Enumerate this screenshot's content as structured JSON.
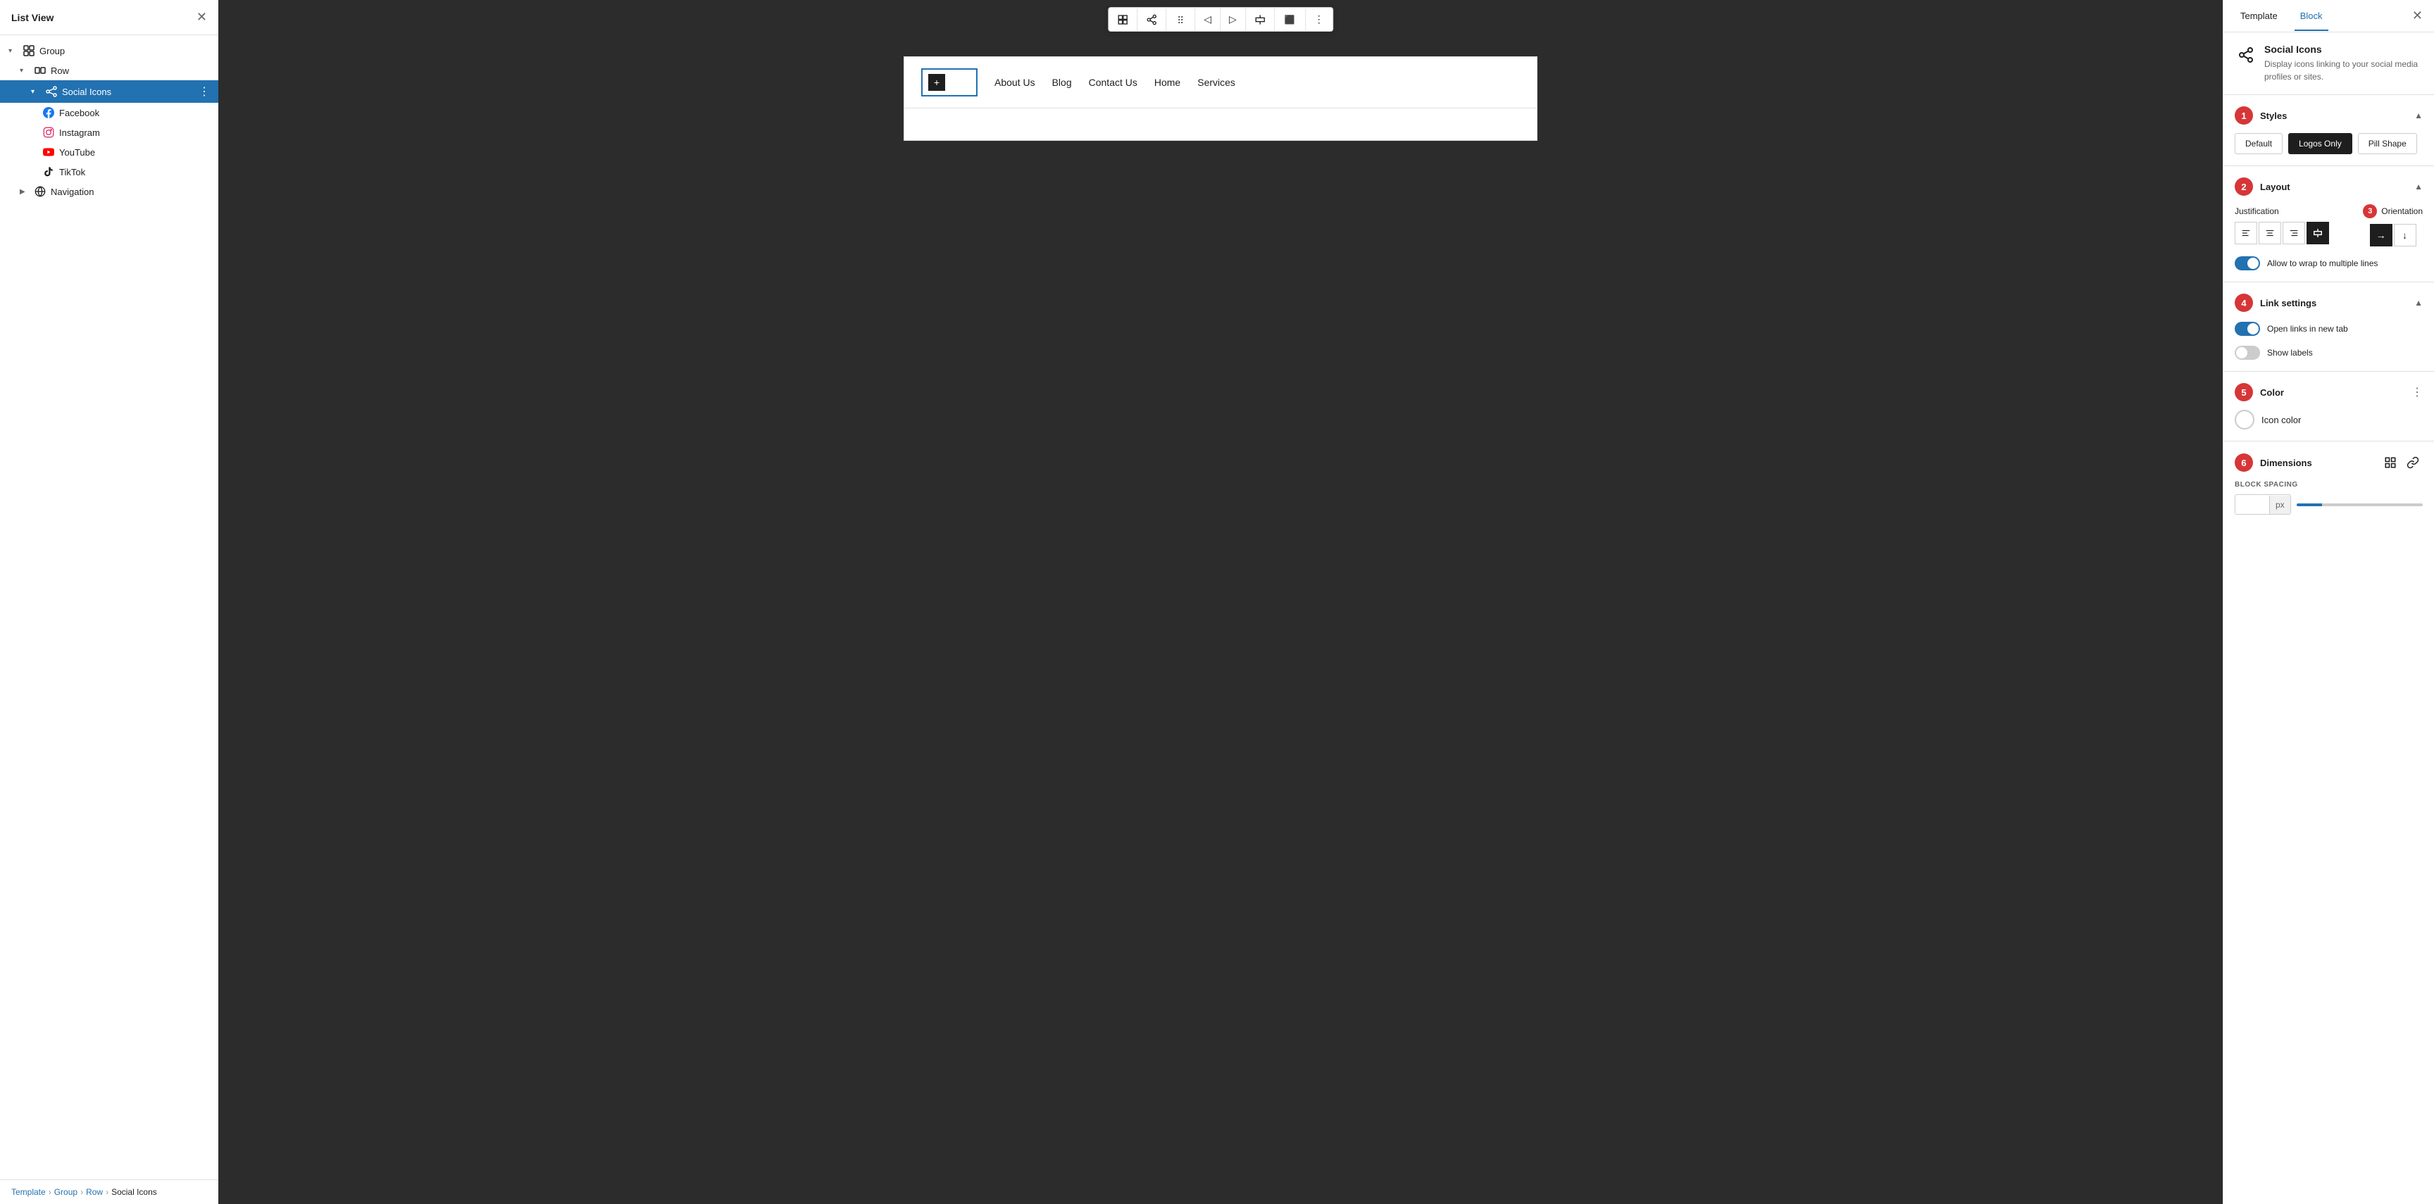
{
  "leftPanel": {
    "title": "List View",
    "tree": [
      {
        "id": "group",
        "label": "Group",
        "icon": "group",
        "level": 0,
        "chevron": "▾",
        "expanded": true
      },
      {
        "id": "row",
        "label": "Row",
        "icon": "row",
        "level": 1,
        "chevron": "▾",
        "expanded": true
      },
      {
        "id": "social-icons",
        "label": "Social Icons",
        "icon": "share",
        "level": 2,
        "chevron": "▾",
        "expanded": true,
        "selected": true
      },
      {
        "id": "facebook",
        "label": "Facebook",
        "icon": "facebook",
        "level": 3
      },
      {
        "id": "instagram",
        "label": "Instagram",
        "icon": "instagram",
        "level": 3
      },
      {
        "id": "youtube",
        "label": "YouTube",
        "icon": "youtube",
        "level": 3
      },
      {
        "id": "tiktok",
        "label": "TikTok",
        "icon": "tiktok",
        "level": 3
      },
      {
        "id": "navigation",
        "label": "Navigation",
        "icon": "navigation",
        "level": 1,
        "chevron": "▶"
      }
    ]
  },
  "breadcrumb": {
    "items": [
      "Template",
      "Group",
      "Row",
      "Social Icons"
    ]
  },
  "canvas": {
    "navLinks": [
      "About Us",
      "Blog",
      "Contact Us",
      "Home",
      "Services"
    ]
  },
  "toolbar": {
    "buttons": [
      "⊞",
      "◁",
      "⋮",
      "◁▷",
      "⬛"
    ]
  },
  "rightPanel": {
    "tabs": [
      "Template",
      "Block"
    ],
    "activeTab": "Block",
    "blockInfo": {
      "title": "Social Icons",
      "description": "Display icons linking to your social media profiles or sites."
    },
    "styles": {
      "title": "Styles",
      "badgeNum": "1",
      "options": [
        "Default",
        "Logos Only",
        "Pill Shape"
      ]
    },
    "layout": {
      "title": "Layout",
      "badgeNum": "2",
      "justification": {
        "label": "Justification",
        "buttons": [
          "align-left",
          "align-center",
          "align-right",
          "align-justify"
        ],
        "activeIndex": 3
      },
      "orientation": {
        "label": "Orientation",
        "badgeNum": "3",
        "buttons": [
          "→",
          "↓"
        ],
        "activeIndex": 0
      },
      "wrap": {
        "label": "Allow to wrap to multiple lines",
        "enabled": true
      }
    },
    "linkSettings": {
      "title": "Link settings",
      "badgeNum": "4",
      "newTab": {
        "label": "Open links in new tab",
        "enabled": true
      },
      "showLabels": {
        "label": "Show labels",
        "enabled": false
      }
    },
    "color": {
      "title": "Color",
      "badgeNum": "5",
      "items": [
        {
          "label": "Icon color"
        }
      ]
    },
    "dimensions": {
      "title": "Dimensions",
      "badgeNum": "6",
      "blockSpacing": {
        "label": "BLOCK SPACING",
        "value": "15",
        "unit": "px"
      }
    }
  }
}
